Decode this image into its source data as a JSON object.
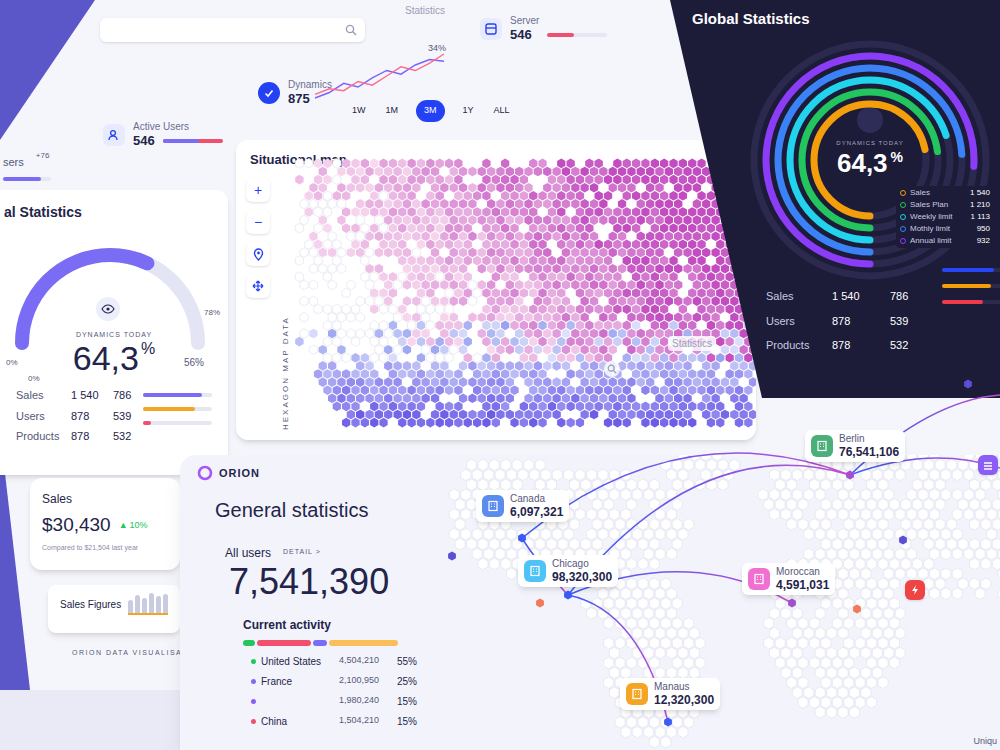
{
  "header": {
    "statistics_tab": "Statistics",
    "users": {
      "label": "sers",
      "delta": "+76",
      "level": 0.8
    },
    "active_users": {
      "label": "Active Users",
      "value": "546",
      "level": 0.6
    },
    "dynamics": {
      "label": "Dynamics",
      "value": "875",
      "peak": "34%",
      "series": [
        {
          "color": "#7b61ff",
          "values": [
            10,
            13,
            18,
            16,
            21,
            25,
            23,
            28,
            31,
            30
          ]
        },
        {
          "color": "#ff6b8a",
          "values": [
            12,
            15,
            14,
            19,
            17,
            22,
            27,
            25,
            29,
            34
          ]
        }
      ]
    },
    "server": {
      "label": "Server",
      "value": "546",
      "level": 0.45
    }
  },
  "map": {
    "title": "Situational map",
    "tabs": [
      {
        "label": "1W",
        "selected": false
      },
      {
        "label": "1M",
        "selected": false
      },
      {
        "label": "3M",
        "selected": true
      },
      {
        "label": "1Y",
        "selected": false
      },
      {
        "label": "ALL",
        "selected": false
      }
    ],
    "zoom": [
      "+",
      "−"
    ],
    "axis_label": "HEXAGON MAP DATA"
  },
  "left_card": {
    "title": "al Statistics",
    "caption": "DYNAMICS TODAY",
    "value": "64,3",
    "unit": "%",
    "gauge_level": 0.64,
    "ticks": [
      "0%",
      "0%",
      "78%",
      "56%"
    ],
    "rows": [
      {
        "label": "Sales",
        "a": "1 540",
        "b": "786"
      },
      {
        "label": "Users",
        "a": "878",
        "b": "539"
      },
      {
        "label": "Products",
        "a": "878",
        "b": "532"
      }
    ],
    "bars": [
      {
        "level": 0.85,
        "color": "#7b6cf6"
      },
      {
        "level": 0.75,
        "color": "#f5a524"
      },
      {
        "level": 0.12,
        "color": "#f0506e"
      }
    ]
  },
  "sales_card": {
    "title": "Sales",
    "value": "$30,430",
    "arrow": "▲",
    "delta": "10%",
    "note": "Compared to $21,504 last year"
  },
  "sales_figures": {
    "title": "Sales Figures",
    "bars": [
      40,
      55,
      48,
      62,
      52,
      58
    ]
  },
  "brand_caption": "ORION DATA VISUALISATION",
  "global": {
    "title": "Global Statistics",
    "caption": "DYNAMICS TODAY",
    "value": "64,3",
    "unit": "%",
    "rings": [
      {
        "label": "Sales",
        "value": "1 540",
        "color": "#f59e0b",
        "level": 0.72
      },
      {
        "label": "Sales Plan",
        "value": "1 210",
        "color": "#22c55e",
        "level": 0.73
      },
      {
        "label": "Weekly limit",
        "value": "1 113",
        "color": "#22d3ee",
        "level": 0.7
      },
      {
        "label": "Mothly limit",
        "value": "950",
        "color": "#3b82f6",
        "level": 0.74
      },
      {
        "label": "Annual limit",
        "value": "932",
        "color": "#8b3cf6",
        "level": 0.76
      }
    ],
    "rows": [
      {
        "label": "Sales",
        "a": "1 540",
        "b": "786"
      },
      {
        "label": "Users",
        "a": "878",
        "b": "539"
      },
      {
        "label": "Products",
        "a": "878",
        "b": "532"
      }
    ],
    "bars": [
      {
        "level": 0.9,
        "color": "#2747f5"
      },
      {
        "level": 0.85,
        "color": "#f59e0b"
      },
      {
        "level": 0.7,
        "color": "#ef3a4a"
      }
    ]
  },
  "lower_label": "Statistics",
  "general": {
    "logo": "ORION",
    "title": "General statistics",
    "all_users_label": "All users",
    "detail": "DETAIL >",
    "total": "7,541,390",
    "activity_title": "Current activity",
    "activity_segments": [
      {
        "level": 0.08,
        "color": "#22c55e"
      },
      {
        "level": 0.36,
        "color": "#f0506e"
      },
      {
        "level": 0.1,
        "color": "#7b6cf6"
      },
      {
        "level": 0.46,
        "color": "#fbbf5a"
      }
    ],
    "rows": [
      {
        "country": "United States",
        "value": "4,504,210",
        "share": "55%",
        "color": "#22c55e"
      },
      {
        "country": "France",
        "value": "2,100,950",
        "share": "25%",
        "color": "#7b6cf6"
      },
      {
        "value": "1,980,240",
        "share": "15%",
        "color": "#8b5cf6"
      },
      {
        "country": "China",
        "value": "1,504,210",
        "share": "15%",
        "color": "#f0506e"
      }
    ]
  },
  "world_map": {
    "pins": [
      {
        "city": "Canada",
        "value": "6,097,321",
        "color": "#5b8def"
      },
      {
        "city": "Chicago",
        "value": "98,320,300",
        "color": "#4fc3f7"
      },
      {
        "city": "Berlin",
        "value": "76,541,106",
        "color": "#4caf7a"
      },
      {
        "city": "Moroccan",
        "value": "4,591,031",
        "color": "#f06fd0"
      },
      {
        "city": "Manaus",
        "value": "12,320,300",
        "color": "#f5a524"
      }
    ],
    "markers": [
      {
        "color": "#ef4444"
      },
      {
        "color": "#8b5cf6"
      }
    ],
    "corner_text": "Uniqu"
  }
}
